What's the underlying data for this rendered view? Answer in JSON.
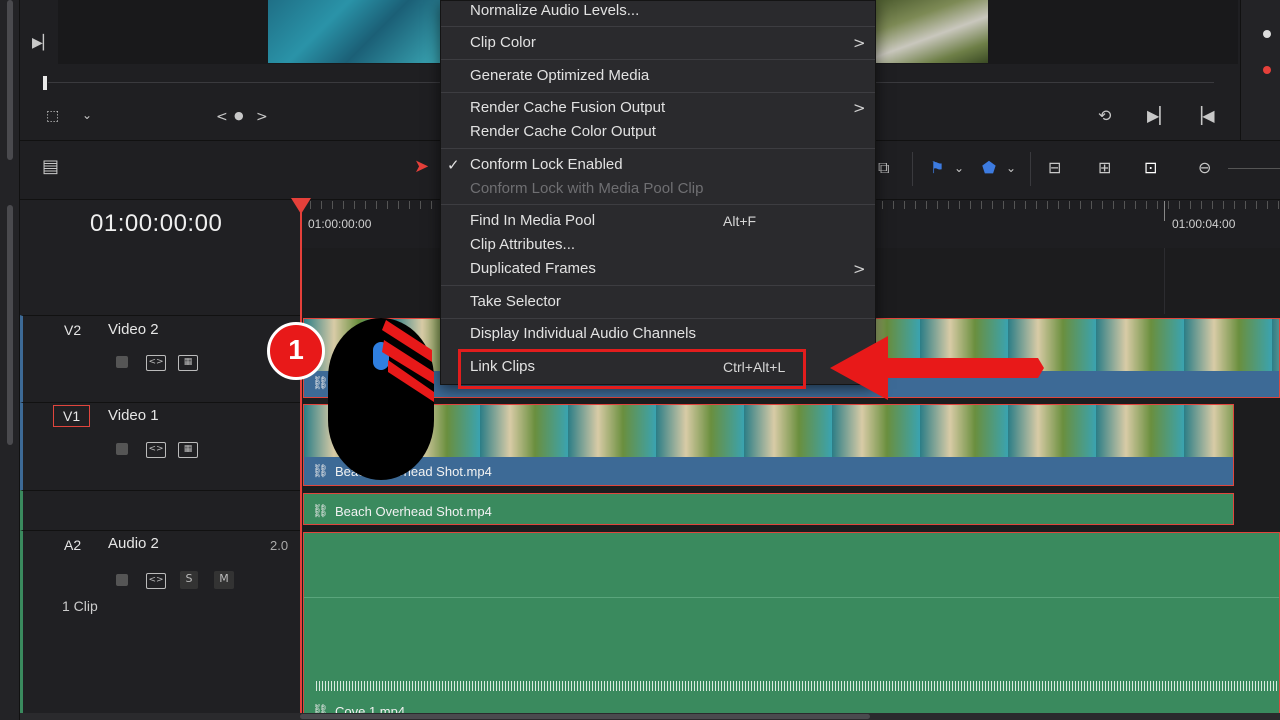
{
  "viewer": {
    "nav_prev": "<",
    "nav_dot": "●",
    "nav_next": ">"
  },
  "timeline": {
    "timecode": "01:00:00:00",
    "ruler_start": "01:00:00:00",
    "ruler_end": "01:00:04:00"
  },
  "tracks": {
    "v2": {
      "id": "V2",
      "name": "Video 2"
    },
    "v1": {
      "id": "V1",
      "name": "Video 1"
    },
    "a2": {
      "id": "A2",
      "name": "Audio 2",
      "channels": "2.0",
      "solo": "S",
      "mute": "M",
      "clip_count": "1 Clip"
    }
  },
  "clips": {
    "v1_label": "Beach Overhead Shot.mp4",
    "a1_label": "Beach Overhead Shot.mp4",
    "a2_label": "Cove 1.mp4"
  },
  "context_menu": {
    "items": [
      {
        "label": "Normalize Audio Levels..."
      },
      {
        "label": "Clip Color"
      },
      {
        "label": "Generate Optimized Media"
      },
      {
        "label": "Render Cache Fusion Output"
      },
      {
        "label": "Render Cache Color Output"
      },
      {
        "label": "Conform Lock Enabled"
      },
      {
        "label": "Conform Lock with Media Pool Clip"
      },
      {
        "label": "Find In Media Pool",
        "shortcut": "Alt+F"
      },
      {
        "label": "Clip Attributes..."
      },
      {
        "label": "Duplicated Frames"
      },
      {
        "label": "Take Selector"
      },
      {
        "label": "Display Individual Audio Channels"
      },
      {
        "label": "Link Clips",
        "shortcut": "Ctrl+Alt+L"
      }
    ],
    "check_glyph": "✓",
    "submenu_glyph": ">"
  },
  "annotation": {
    "step_number": "1",
    "highlight_color": "#e21d1d"
  },
  "colors": {
    "playhead": "#e5403a",
    "video_clip": "#3d6a96",
    "audio_clip": "#3a8a5e"
  }
}
